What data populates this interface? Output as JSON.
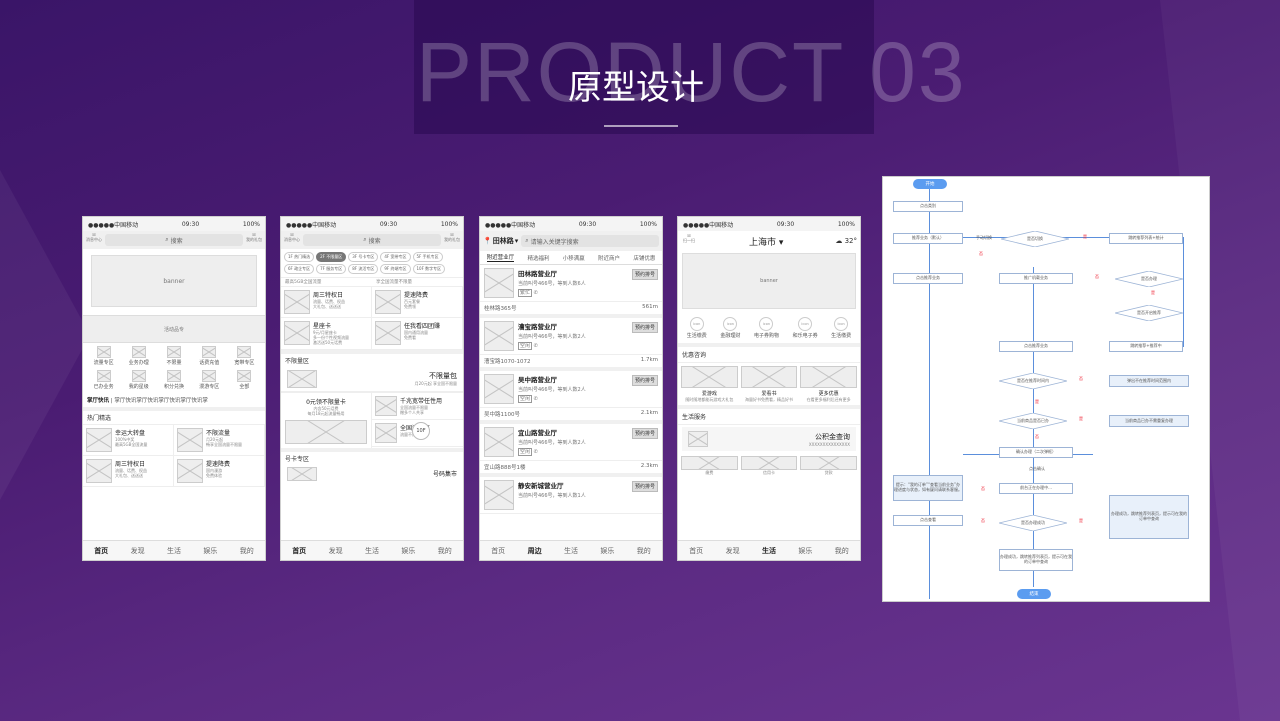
{
  "header": {
    "big_word": "PRODUCT 03",
    "title": "原型设计"
  },
  "common": {
    "carrier": "●●●●●中国移动",
    "time": "09:30",
    "battery": "100%",
    "tabs": [
      "首页",
      "发现",
      "生活",
      "娱乐",
      "我的"
    ],
    "tabs_nearby": [
      "首页",
      "周边",
      "生活",
      "娱乐",
      "我的"
    ]
  },
  "phone1": {
    "left_icon": "消息中心",
    "right_icon": "我的礼包",
    "search": "搜索",
    "banner": "banner",
    "activity": "活动品专",
    "icon_label": "icon",
    "grid": [
      "流量专区",
      "业务办理",
      "不限量",
      "话费充值",
      "宽带专区",
      "已办业务",
      "我的星级",
      "积分兑换",
      "漫游专区",
      "全部"
    ],
    "news_label": "掌厅快讯",
    "news_text": "掌厅快讯掌厅快讯掌厅快讯掌厅快讯掌",
    "section": "热门精选",
    "cards": [
      {
        "title": "幸运大转盘",
        "lines": [
          "100%中奖",
          "最高5GB全国流量"
        ]
      },
      {
        "title": "不限流量",
        "lines": [
          "月20元起",
          "畅享全国流量不限量"
        ]
      },
      {
        "title": "周三特权日",
        "lines": [
          "流量、话费、权益",
          "大礼包、送送送"
        ]
      },
      {
        "title": "提速降费",
        "lines": [
          "国内漫游",
          "免费体验"
        ]
      }
    ]
  },
  "phone2": {
    "left_icon": "消息中心",
    "right_icon": "我的礼包",
    "search": "搜索",
    "chips": [
      "1F 热门精选",
      "2F 不限量区",
      "3F 号卡专区",
      "4F 宽带专区",
      "5F 手机专区",
      "6F 政企专区",
      "7F 服务专区",
      "8F 流活专区",
      "9F 终端专区",
      "10F 数字专区"
    ],
    "top_left": "最高5GB全国流量",
    "top_right": "享全国流量不限量",
    "cards": [
      {
        "title": "周三特权日",
        "lines": [
          "流量、话费、权益",
          "大礼包、送送送"
        ]
      },
      {
        "title": "提速降费",
        "lines": [
          "百元套餐",
          "免费领"
        ]
      },
      {
        "title": "星座卡",
        "lines": [
          "9元/月星座卡",
          "多一份个性视频流量",
          "激活送50元话费"
        ]
      },
      {
        "title": "任我看四团赚",
        "lines": [
          "国内通用流量",
          "免费看"
        ]
      }
    ],
    "unlimited_section": "不限量区",
    "unlimited_title": "不限量包",
    "unlimited_sub": "月20元起 享全国不限量",
    "card_a_title": "0元领不限量卡",
    "card_a_lines": [
      "内含50元话费",
      "每月18元起流量畅用"
    ],
    "card_b_title": "千兆宽带任性用",
    "card_b_lines": [
      "全国流量不限量",
      "赠多个人共享"
    ],
    "card_c_title": "全国流量享",
    "card_c_lines": [
      "流量不限量"
    ],
    "float_label": "10F",
    "number_section": "号卡专区",
    "number_title": "号码集市"
  },
  "phone3": {
    "location": "田林路",
    "search": "请输入关键字搜索",
    "tabs": [
      "附近营业厅",
      "精选福利",
      "小移满赢",
      "附近商户",
      "店铺优惠"
    ],
    "stores": [
      {
        "name": "田林路营业厅",
        "desc": "当前叫号466号，等到人数6人",
        "tag": "繁忙",
        "addr": "桂林路365号",
        "dist": "561m"
      },
      {
        "name": "漕宝路营业厅",
        "desc": "当前叫号466号，等到人数2人",
        "tag": "空闲",
        "addr": "漕宝路1070-1072",
        "dist": "1.7km"
      },
      {
        "name": "吴中路营业厅",
        "desc": "当前叫号466号，等到人数2人",
        "tag": "空闲",
        "addr": "吴中路1100号",
        "dist": "2.1km"
      },
      {
        "name": "宜山路营业厅",
        "desc": "当前叫号466号，等到人数2人",
        "tag": "空闲",
        "addr": "宜山路888号1楼",
        "dist": "2.3km"
      },
      {
        "name": "静安新城营业厅",
        "desc": "当前叫号466号，等到人数1人",
        "tag": "空闲",
        "addr": "",
        "dist": ""
      }
    ],
    "button": "预约排号"
  },
  "phone4": {
    "scan": "扫一扫",
    "city": "上海市",
    "weather": "32°",
    "banner": "banner",
    "icon_label": "icon",
    "icons": [
      "生活缴费",
      "金融理财",
      "电子券购物",
      "和乐电子券",
      "生活缴费"
    ],
    "sec1": "优惠咨询",
    "promo": [
      {
        "title": "爱游戏",
        "sub": "随时随地都能玩游戏大礼包"
      },
      {
        "title": "爱看书",
        "sub": "海量好书免费看，精品好书"
      },
      {
        "title": "更多优惠",
        "sub": "在看更多福利后还有更多"
      }
    ],
    "sec2": "生活服务",
    "service_title": "公积金查询",
    "service_sub": "XXXXXXXXXXXXXXX",
    "services": [
      "缴费",
      "信用卡",
      "贷款"
    ]
  },
  "flow": {
    "start": "开始",
    "end": "结束",
    "yes": "是",
    "no": "否",
    "nodes": [
      "点击类别",
      "推荐业务（默认）",
      "手动切换",
      "是否切换",
      "跳转推荐列表+统计",
      "点击推荐业务",
      "推广机载业务",
      "是否办理",
      "是否开启推荐",
      "点击推荐业务",
      "跳转推荐+推荐中",
      "是否在推荐时间内",
      "弹出不在推荐时间范围内",
      "当前商品是否已办",
      "当前商品已办不需重复办理",
      "确认办理（二次弹框）",
      "点击确认",
      "前台正在办理中...",
      "是否办理成功",
      "点击查看",
      "办理成功，跳转推荐列表页，提示可在我的订单中查询",
      "提示：“我的订单”“查看当前业务”办理进度与状态，如有疑问请联系客服。"
    ]
  }
}
